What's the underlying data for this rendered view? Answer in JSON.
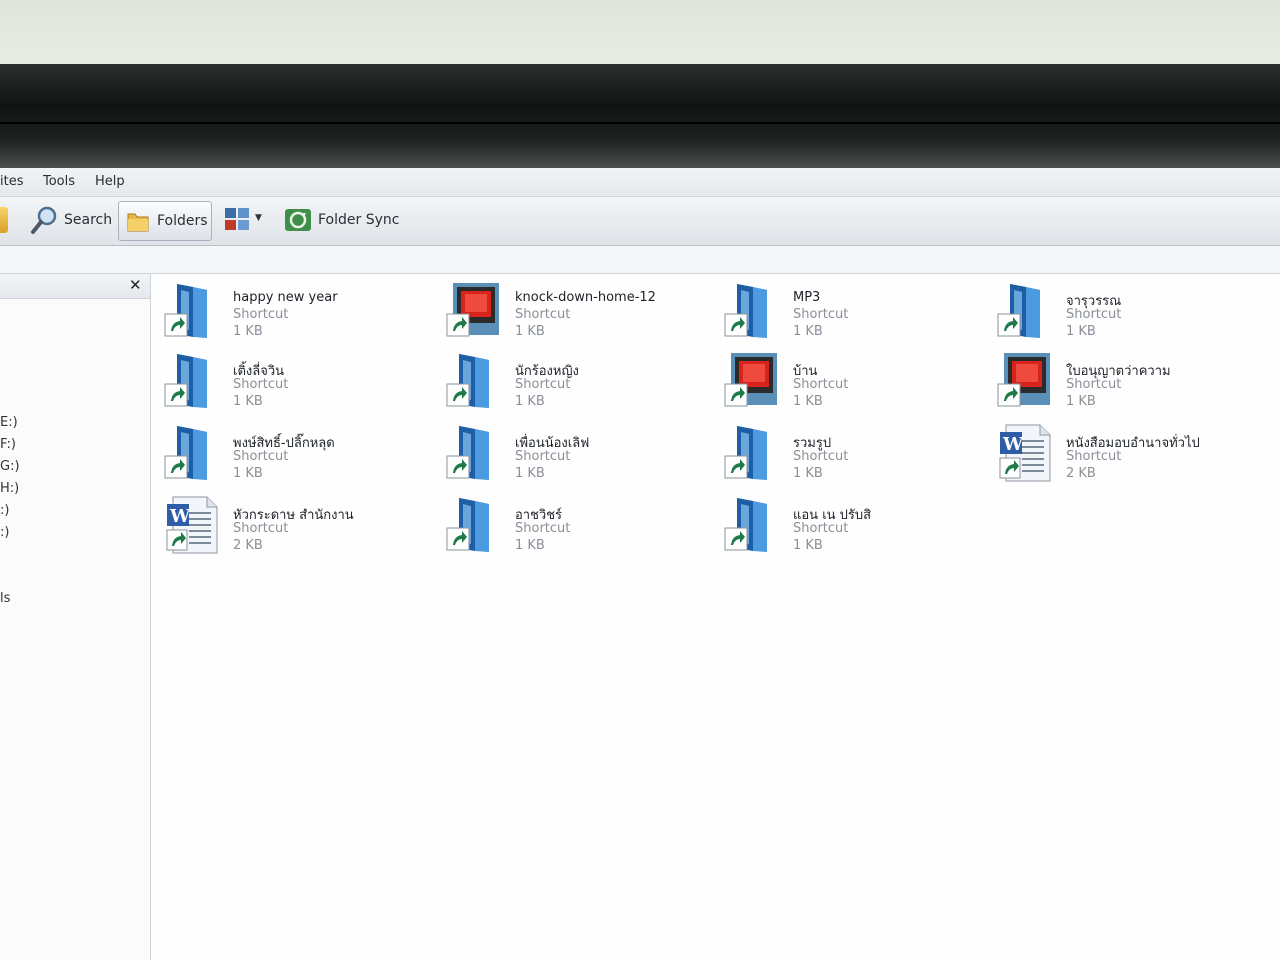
{
  "menu": [
    "ites",
    "Tools",
    "Help"
  ],
  "toolbar": {
    "search": "Search",
    "folders": "Folders",
    "sync": "Folder Sync"
  },
  "sidebar": {
    "close": "✕",
    "drives": [
      "E:)",
      "F:)",
      "G:)",
      "H:)",
      ":)",
      ":)"
    ],
    "bottom": "ls"
  },
  "files": [
    {
      "name": "happy new year",
      "type": "Shortcut",
      "size": "1 KB",
      "icon": "folder-shortcut-icon"
    },
    {
      "name": "knock-down-home-12",
      "type": "Shortcut",
      "size": "1 KB",
      "icon": "media-shortcut-icon"
    },
    {
      "name": "MP3",
      "type": "Shortcut",
      "size": "1 KB",
      "icon": "folder-shortcut-icon"
    },
    {
      "name": "จารุวรรณ",
      "type": "Shortcut",
      "size": "1 KB",
      "icon": "folder-shortcut-icon"
    },
    {
      "name": "เติ้งลี่จวิน",
      "type": "Shortcut",
      "size": "1 KB",
      "icon": "folder-shortcut-icon"
    },
    {
      "name": "นักร้องหญิง",
      "type": "Shortcut",
      "size": "1 KB",
      "icon": "folder-shortcut-icon"
    },
    {
      "name": "บ้าน",
      "type": "Shortcut",
      "size": "1 KB",
      "icon": "media-shortcut-icon"
    },
    {
      "name": "ใบอนุญาตว่าความ",
      "type": "Shortcut",
      "size": "1 KB",
      "icon": "media-shortcut-icon"
    },
    {
      "name": "พงษ์สิทธิ์-ปลิ๊กหลุด",
      "type": "Shortcut",
      "size": "1 KB",
      "icon": "folder-shortcut-icon"
    },
    {
      "name": "เพื่อนน้องเลิฟ",
      "type": "Shortcut",
      "size": "1 KB",
      "icon": "folder-shortcut-icon"
    },
    {
      "name": "รวมรูป",
      "type": "Shortcut",
      "size": "1 KB",
      "icon": "folder-shortcut-icon"
    },
    {
      "name": "หนังสือมอบอำนาจทั่วไป",
      "type": "Shortcut",
      "size": "2 KB",
      "icon": "word-doc-shortcut-icon"
    },
    {
      "name": "หัวกระดาษ  สำนักงาน",
      "type": "Shortcut",
      "size": "2 KB",
      "icon": "word-doc-shortcut-icon"
    },
    {
      "name": "อาชวิชร์",
      "type": "Shortcut",
      "size": "1 KB",
      "icon": "folder-shortcut-icon"
    },
    {
      "name": "แอน เน ปรับสิ",
      "type": "Shortcut",
      "size": "1 KB",
      "icon": "folder-shortcut-icon"
    }
  ]
}
